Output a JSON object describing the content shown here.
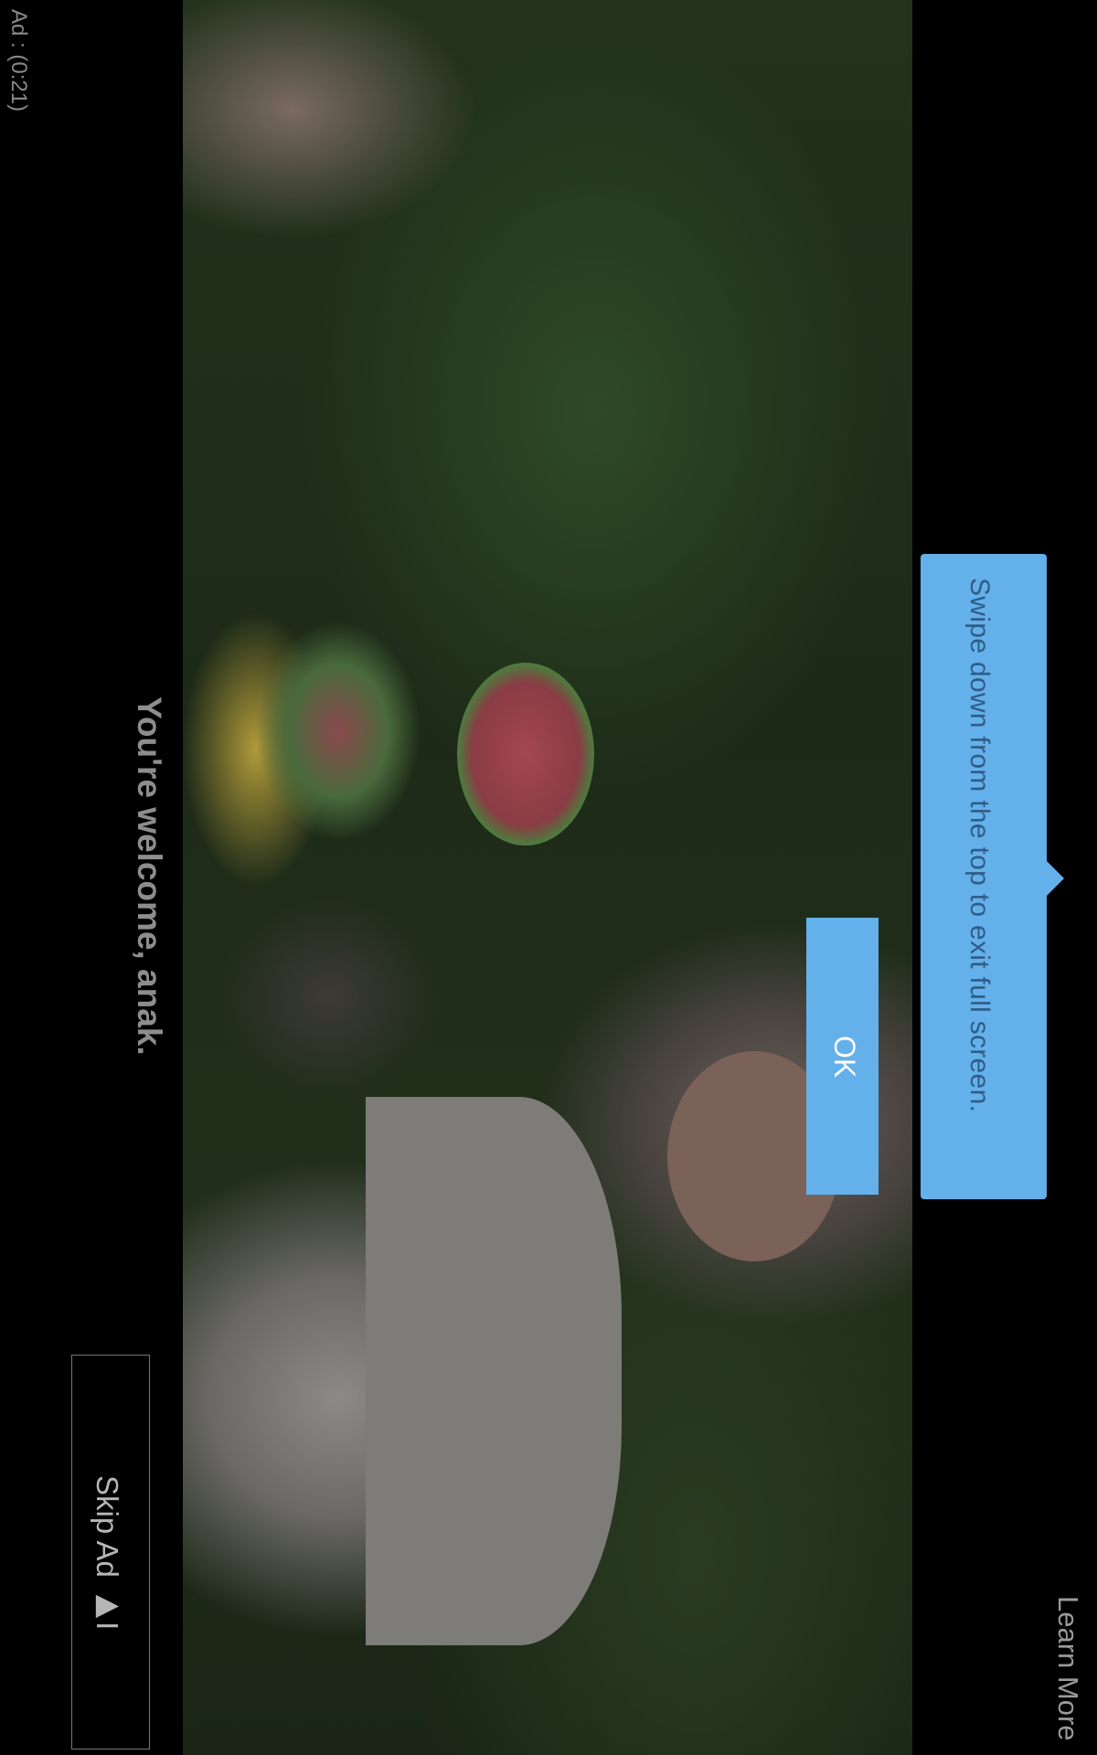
{
  "ad": {
    "timer_text": "Ad : (0:21)"
  },
  "video": {
    "caption": "You're welcome, anak."
  },
  "skip": {
    "label": "Skip Ad ▶I"
  },
  "learn_more": {
    "label": "Learn More"
  },
  "tooltip": {
    "message": "Swipe down from the top to exit full screen.",
    "ok_label": "OK",
    "color": "#64b0ea"
  }
}
